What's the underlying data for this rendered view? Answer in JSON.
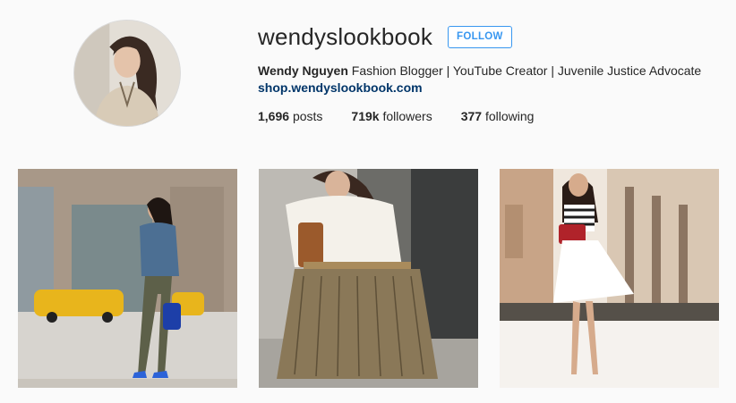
{
  "profile": {
    "username": "wendyslookbook",
    "follow_label": "FOLLOW",
    "full_name": "Wendy Nguyen",
    "bio": "Fashion Blogger | YouTube Creator | Juvenile Justice Advocate",
    "website": "shop.wendyslookbook.com"
  },
  "stats": {
    "posts_count": "1,696",
    "posts_label": "posts",
    "followers_count": "719k",
    "followers_label": "followers",
    "following_count": "377",
    "following_label": "following"
  },
  "colors": {
    "accent": "#3897f0",
    "link": "#003569",
    "text": "#262626",
    "background": "#fafafa"
  },
  "posts": [
    {
      "description": "street-style-photo-denim"
    },
    {
      "description": "fringe-skirt-photo"
    },
    {
      "description": "striped-top-white-skirt-photo"
    }
  ]
}
